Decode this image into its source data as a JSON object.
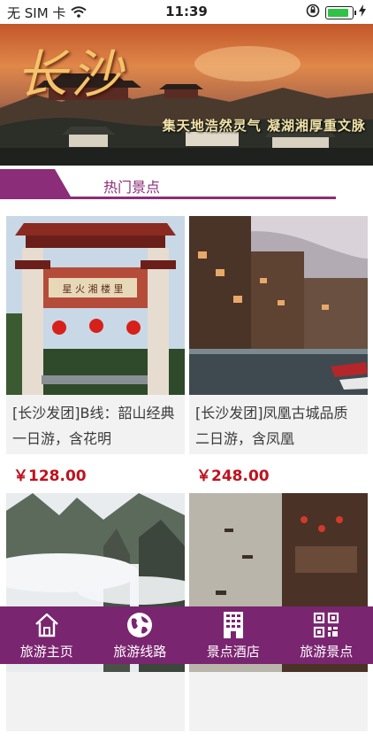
{
  "status_bar": {
    "carrier": "无 SIM 卡",
    "time": "11:39",
    "battery_level": 0.9
  },
  "banner": {
    "title": "长沙",
    "slogan": "集天地浩然灵气  凝湖湘厚重文脉"
  },
  "section": {
    "title": "热门景点"
  },
  "cards": [
    {
      "title": "[长沙发团]B线：韶山经典一日游，含花明",
      "price": "￥128.00",
      "image": "gate-photo"
    },
    {
      "title": "[长沙发团]凤凰古城品质二日游，含凤凰",
      "price": "￥248.00",
      "image": "river-town-photo"
    },
    {
      "title": "",
      "price": "",
      "image": "mountain-peaks-photo"
    },
    {
      "title": "",
      "price": "",
      "image": "river-boats-photo"
    }
  ],
  "tabbar": {
    "items": [
      {
        "label": "旅游主页",
        "icon": "home-icon"
      },
      {
        "label": "旅游线路",
        "icon": "globe-icon"
      },
      {
        "label": "景点酒店",
        "icon": "building-icon"
      },
      {
        "label": "旅游景点",
        "icon": "qr-code-icon"
      }
    ]
  },
  "colors": {
    "accent": "#8b2d78",
    "tabbar": "#7a2570",
    "price": "#c0121e"
  }
}
